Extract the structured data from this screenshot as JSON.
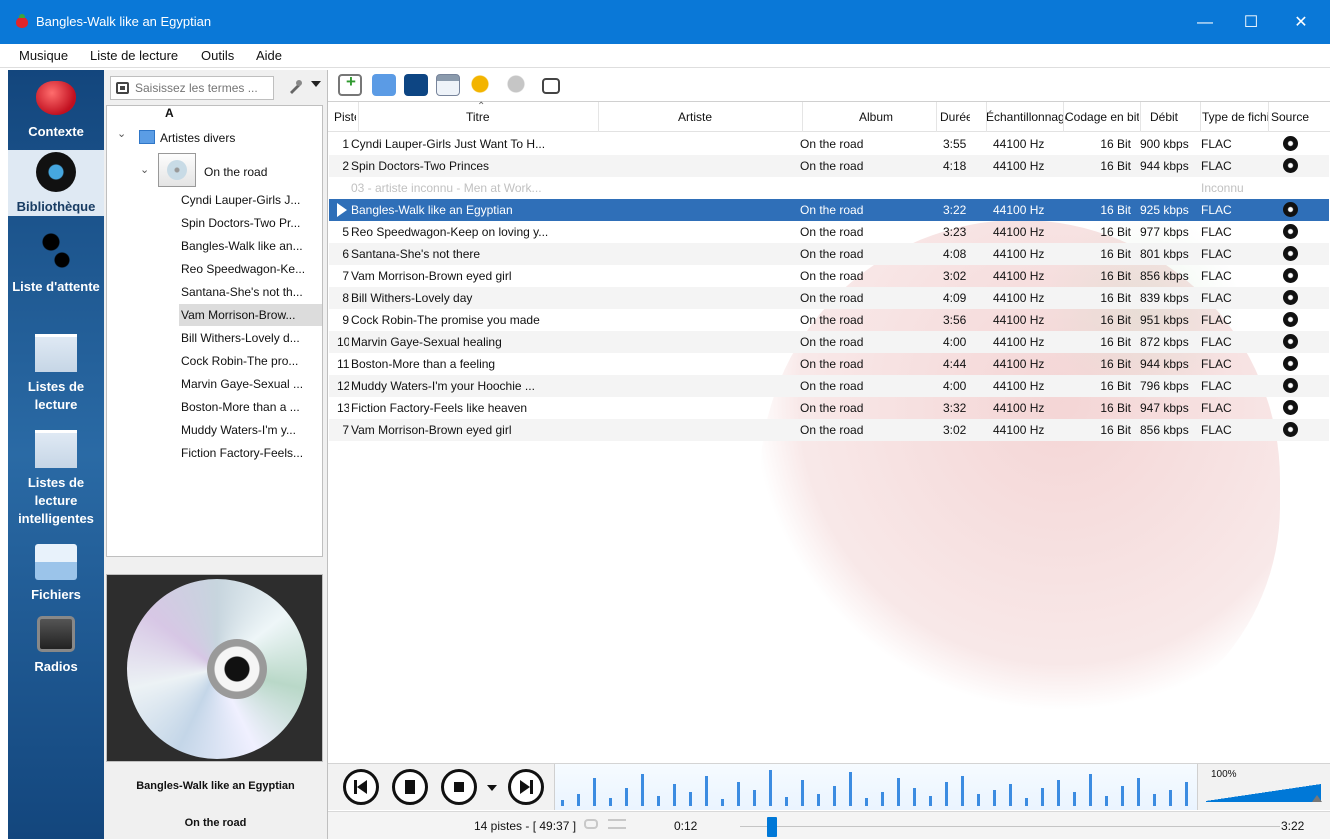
{
  "window": {
    "title": "Bangles-Walk like an Egyptian",
    "accent_color": "#0a78d7",
    "buttons": [
      "—",
      "☐",
      "✕"
    ]
  },
  "menu": {
    "items": [
      "Musique",
      "Liste de lecture",
      "Outils",
      "Aide"
    ]
  },
  "nav": {
    "items": [
      {
        "label": "Contexte",
        "icon": "strawberry-icon",
        "active": false
      },
      {
        "label": "Bibliothèque",
        "icon": "vinyl-icon",
        "active": true
      },
      {
        "label": "Liste d'attente",
        "icon": "footsteps-icon",
        "active": false
      },
      {
        "label": "Listes de lecture",
        "icon": "playlist-icon",
        "active": false
      },
      {
        "label": "Listes de lecture intelligentes",
        "icon": "smart-playlist-icon",
        "active": false
      },
      {
        "label": "Fichiers",
        "icon": "files-icon",
        "active": false
      },
      {
        "label": "Radios",
        "icon": "radio-icon",
        "active": false
      }
    ]
  },
  "library": {
    "search_placeholder": "Saisissez les termes ...",
    "tree_header": "A",
    "root": {
      "label": "Artistes divers"
    },
    "album": {
      "label": "On the road"
    },
    "tracks": [
      {
        "label": "Cyndi Lauper-Girls J..."
      },
      {
        "label": "Spin Doctors-Two Pr..."
      },
      {
        "label": "Bangles-Walk like an..."
      },
      {
        "label": "Reo Speedwagon-Ke..."
      },
      {
        "label": "Santana-She's not th..."
      },
      {
        "label": "Vam Morrison-Brow...",
        "selected": true
      },
      {
        "label": "Bill Withers-Lovely d..."
      },
      {
        "label": "Cock Robin-The pro..."
      },
      {
        "label": "Marvin Gaye-Sexual ..."
      },
      {
        "label": "Boston-More than a ..."
      },
      {
        "label": "Muddy Waters-I'm y..."
      },
      {
        "label": "Fiction Factory-Feels..."
      }
    ]
  },
  "now_playing": {
    "artist_title": "Bangles-Walk like an Egyptian",
    "album": "On the road"
  },
  "playlist": {
    "columns": [
      "Piste",
      "Titre",
      "Artiste",
      "Album",
      "Durée",
      "Échantillonnage",
      "Codage en bits",
      "Débit",
      "Type de fichier",
      "Source"
    ],
    "rows": [
      {
        "track": "1",
        "title": "Cyndi Lauper-Girls Just Want To H...",
        "album": "On the road",
        "duration": "3:55",
        "sample_rate": "44100 Hz",
        "bit_depth": "16 Bit",
        "bitrate": "900 kbps",
        "format": "FLAC"
      },
      {
        "track": "2",
        "title": "Spin Doctors-Two Princes",
        "album": "On the road",
        "duration": "4:18",
        "sample_rate": "44100 Hz",
        "bit_depth": "16 Bit",
        "bitrate": "944 kbps",
        "format": "FLAC"
      },
      {
        "track": "",
        "title": "03 - artiste inconnu - Men at Work...",
        "album": "",
        "duration": "",
        "sample_rate": "",
        "bit_depth": "",
        "bitrate": "",
        "format": "Inconnu",
        "state": "unknown"
      },
      {
        "track": "",
        "title": "Bangles-Walk like an Egyptian",
        "album": "On the road",
        "duration": "3:22",
        "sample_rate": "44100 Hz",
        "bit_depth": "16 Bit",
        "bitrate": "925 kbps",
        "format": "FLAC",
        "state": "current"
      },
      {
        "track": "5",
        "title": "Reo Speedwagon-Keep on loving y...",
        "album": "On the road",
        "duration": "3:23",
        "sample_rate": "44100 Hz",
        "bit_depth": "16 Bit",
        "bitrate": "977 kbps",
        "format": "FLAC"
      },
      {
        "track": "6",
        "title": "Santana-She's not there",
        "album": "On the road",
        "duration": "4:08",
        "sample_rate": "44100 Hz",
        "bit_depth": "16 Bit",
        "bitrate": "801 kbps",
        "format": "FLAC"
      },
      {
        "track": "7",
        "title": "Vam Morrison-Brown eyed girl",
        "album": "On the road",
        "duration": "3:02",
        "sample_rate": "44100 Hz",
        "bit_depth": "16 Bit",
        "bitrate": "856 kbps",
        "format": "FLAC"
      },
      {
        "track": "8",
        "title": "Bill Withers-Lovely day",
        "album": "On the road",
        "duration": "4:09",
        "sample_rate": "44100 Hz",
        "bit_depth": "16 Bit",
        "bitrate": "839 kbps",
        "format": "FLAC"
      },
      {
        "track": "9",
        "title": "Cock Robin-The promise you made",
        "album": "On the road",
        "duration": "3:56",
        "sample_rate": "44100 Hz",
        "bit_depth": "16 Bit",
        "bitrate": "951 kbps",
        "format": "FLAC"
      },
      {
        "track": "10",
        "title": "Marvin Gaye-Sexual healing",
        "album": "On the road",
        "duration": "4:00",
        "sample_rate": "44100 Hz",
        "bit_depth": "16 Bit",
        "bitrate": "872 kbps",
        "format": "FLAC"
      },
      {
        "track": "11",
        "title": "Boston-More than a feeling",
        "album": "On the road",
        "duration": "4:44",
        "sample_rate": "44100 Hz",
        "bit_depth": "16 Bit",
        "bitrate": "944 kbps",
        "format": "FLAC"
      },
      {
        "track": "12",
        "title": "Muddy Waters-I'm your Hoochie ...",
        "album": "On the road",
        "duration": "4:00",
        "sample_rate": "44100 Hz",
        "bit_depth": "16 Bit",
        "bitrate": "796 kbps",
        "format": "FLAC"
      },
      {
        "track": "13",
        "title": "Fiction Factory-Feels like heaven",
        "album": "On the road",
        "duration": "3:32",
        "sample_rate": "44100 Hz",
        "bit_depth": "16 Bit",
        "bitrate": "947 kbps",
        "format": "FLAC"
      },
      {
        "track": "7",
        "title": "Vam Morrison-Brown eyed girl",
        "album": "On the road",
        "duration": "3:02",
        "sample_rate": "44100 Hz",
        "bit_depth": "16 Bit",
        "bitrate": "856 kbps",
        "format": "FLAC"
      }
    ]
  },
  "player": {
    "volume_label": "100%",
    "volume_level": 1.0
  },
  "status": {
    "track_count": "14 pistes - [ 49:37 ]",
    "elapsed": "0:12",
    "total": "3:22",
    "progress_fraction": 0.06
  }
}
